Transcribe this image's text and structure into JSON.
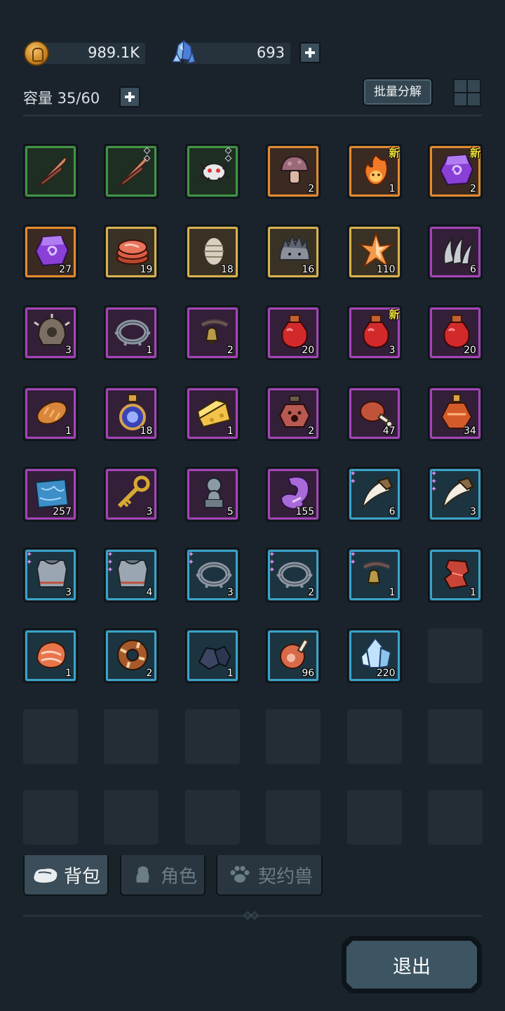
{
  "currency": {
    "gold": {
      "value": "989.1K",
      "icon": "gold-coin-icon"
    },
    "gems": {
      "value": "693",
      "icon": "crystal-icon"
    }
  },
  "inventory": {
    "capacity_label": "容量 35/60",
    "bulk_decompose_label": "批量分解",
    "new_label": "新",
    "rows": [
      [
        {
          "name": "feather-icon",
          "rarity": "green",
          "count": "",
          "locked": false,
          "new": false
        },
        {
          "name": "feather-icon",
          "rarity": "green",
          "count": "",
          "locked": true,
          "new": false
        },
        {
          "name": "spider-icon",
          "rarity": "green",
          "count": "",
          "locked": true,
          "new": false
        },
        {
          "name": "mushroom-icon",
          "rarity": "orange",
          "count": "2",
          "locked": false,
          "new": false
        },
        {
          "name": "fire-spirit-icon",
          "rarity": "orange",
          "count": "1",
          "locked": false,
          "new": true
        },
        {
          "name": "purple-rune-stone-icon",
          "rarity": "orange",
          "count": "2",
          "locked": false,
          "new": true
        }
      ],
      [
        {
          "name": "purple-rune-stone-icon",
          "rarity": "orange",
          "count": "27"
        },
        {
          "name": "raw-meat-icon",
          "rarity": "gold",
          "count": "19"
        },
        {
          "name": "larva-icon",
          "rarity": "gold",
          "count": "18"
        },
        {
          "name": "hedgehog-icon",
          "rarity": "gold",
          "count": "16"
        },
        {
          "name": "fire-crystal-icon",
          "rarity": "gold",
          "count": "110"
        },
        {
          "name": "claw-icon",
          "rarity": "purple",
          "count": "6"
        }
      ],
      [
        {
          "name": "spiked-helmet-icon",
          "rarity": "purple",
          "count": "3"
        },
        {
          "name": "spiked-ring-icon",
          "rarity": "purple",
          "count": "1"
        },
        {
          "name": "bell-collar-icon",
          "rarity": "purple",
          "count": "2"
        },
        {
          "name": "red-potion-icon",
          "rarity": "purple",
          "count": "20"
        },
        {
          "name": "red-potion-icon",
          "rarity": "purple",
          "count": "3",
          "new": true
        },
        {
          "name": "red-potion-icon",
          "rarity": "purple",
          "count": "20"
        }
      ],
      [
        {
          "name": "bread-icon",
          "rarity": "purple",
          "count": "1"
        },
        {
          "name": "magic-flask-icon",
          "rarity": "purple",
          "count": "18"
        },
        {
          "name": "cheese-icon",
          "rarity": "purple",
          "count": "1"
        },
        {
          "name": "paw-potion-icon",
          "rarity": "purple",
          "count": "2"
        },
        {
          "name": "meat-leg-icon",
          "rarity": "purple",
          "count": "47"
        },
        {
          "name": "orange-flask-icon",
          "rarity": "purple",
          "count": "34"
        }
      ],
      [
        {
          "name": "map-scroll-icon",
          "rarity": "purple",
          "count": "257"
        },
        {
          "name": "golden-key-icon",
          "rarity": "purple",
          "count": "3"
        },
        {
          "name": "statue-icon",
          "rarity": "purple",
          "count": "5"
        },
        {
          "name": "amethyst-icon",
          "rarity": "purple",
          "count": "155"
        },
        {
          "name": "fang-icon",
          "rarity": "blue",
          "count": "6",
          "stars": 2
        },
        {
          "name": "fang-icon",
          "rarity": "blue",
          "count": "3",
          "stars": 3
        }
      ],
      [
        {
          "name": "armor-icon",
          "rarity": "blue",
          "count": "3",
          "stars": 2
        },
        {
          "name": "armor-icon",
          "rarity": "blue",
          "count": "4",
          "stars": 3
        },
        {
          "name": "spiked-ring-icon",
          "rarity": "blue",
          "count": "3",
          "stars": 2
        },
        {
          "name": "spiked-ring-icon",
          "rarity": "blue",
          "count": "2",
          "stars": 3
        },
        {
          "name": "bell-collar-icon",
          "rarity": "blue",
          "count": "1",
          "stars": 2
        },
        {
          "name": "red-gauntlet-icon",
          "rarity": "blue",
          "count": "1"
        }
      ],
      [
        {
          "name": "salmon-icon",
          "rarity": "blue",
          "count": "1"
        },
        {
          "name": "donut-icon",
          "rarity": "blue",
          "count": "2"
        },
        {
          "name": "dark-ore-icon",
          "rarity": "blue",
          "count": "1"
        },
        {
          "name": "ham-icon",
          "rarity": "blue",
          "count": "96"
        },
        {
          "name": "ice-crystal-icon",
          "rarity": "blue",
          "count": "220"
        },
        null
      ],
      [
        null,
        null,
        null,
        null,
        null,
        null
      ],
      [
        null,
        null,
        null,
        null,
        null,
        null
      ]
    ]
  },
  "tabs": {
    "backpack": "背包",
    "role": "角色",
    "pet": "契约兽"
  },
  "exit_label": "退出",
  "colors": {
    "background": "#1a232b",
    "green": "#3f9443",
    "orange": "#e48a2e",
    "gold": "#d8b14d",
    "purple": "#a444b8",
    "blue": "#3aa3c9",
    "new": "#ede13a"
  }
}
